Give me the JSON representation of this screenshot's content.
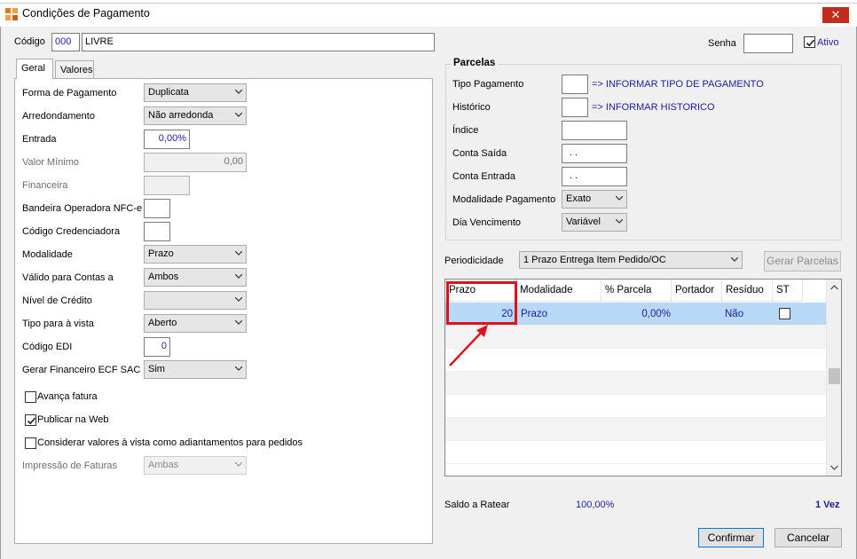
{
  "window": {
    "title": "Condições de Pagamento",
    "close": "✕"
  },
  "header": {
    "codigo_label": "Código",
    "codigo_value": "000",
    "descricao_value": "LIVRE",
    "senha_label": "Senha",
    "senha_value": "",
    "ativo_label": "Ativo",
    "ativo_checked": true
  },
  "tabs": [
    {
      "label": "Geral",
      "active": true
    },
    {
      "label": "Valores",
      "active": false
    }
  ],
  "geral": {
    "forma_pagamento": {
      "label": "Forma de Pagamento",
      "value": "Duplicata"
    },
    "arredondamento": {
      "label": "Arredondamento",
      "value": "Não arredonda"
    },
    "entrada": {
      "label": "Entrada",
      "value": "0,00%"
    },
    "valor_minimo": {
      "label": "Valor Mínimo",
      "value": "0,00"
    },
    "financeira": {
      "label": "Financeira",
      "value": ""
    },
    "bandeira": {
      "label": "Bandeira Operadora NFC-e",
      "value": ""
    },
    "credenciadora": {
      "label": "Código Credenciadora",
      "value": ""
    },
    "modalidade": {
      "label": "Modalidade",
      "value": "Prazo"
    },
    "valido_contas": {
      "label": "Válido para Contas a",
      "value": "Ambos"
    },
    "nivel_credito": {
      "label": "Nível de Crédito",
      "value": ""
    },
    "tipo_vista": {
      "label": "Tipo para à vista",
      "value": "Aberto"
    },
    "codigo_edi": {
      "label": "Código EDI",
      "value": "0"
    },
    "gerar_financeiro": {
      "label": "Gerar Financeiro ECF SAC",
      "value": "Sim"
    },
    "avanca_fatura": {
      "label": "Avança fatura",
      "checked": false
    },
    "publicar_web": {
      "label": "Publicar na Web",
      "checked": true
    },
    "considerar_valores": {
      "label": "Considerar valores à vista como adiantamentos para pedidos",
      "checked": false
    },
    "impressao_faturas": {
      "label": "Impressão de Faturas",
      "value": "Ambas"
    }
  },
  "parcelas": {
    "title": "Parcelas",
    "tipo_pagamento": {
      "label": "Tipo Pagamento",
      "value": "",
      "hint": "=> INFORMAR TIPO DE PAGAMENTO"
    },
    "historico": {
      "label": "Histórico",
      "value": "",
      "hint": "=> INFORMAR HISTORICO"
    },
    "indice": {
      "label": "Índice",
      "value": ""
    },
    "conta_saida": {
      "label": "Conta Saída",
      "value": ". ."
    },
    "conta_entrada": {
      "label": "Conta Entrada",
      "value": ". ."
    },
    "modalidade_pagamento": {
      "label": "Modalidade Pagamento",
      "value": "Exato"
    },
    "dia_vencimento": {
      "label": "Dia Vencimento",
      "value": "Variável"
    }
  },
  "periodicidade": {
    "label": "Periodicidade",
    "value": "1 Prazo Entrega Item Pedido/OC"
  },
  "gerar_parcelas_label": "Gerar Parcelas",
  "grid": {
    "columns": [
      "Prazo",
      "Modalidade",
      "% Parcela",
      "Portador",
      "Resíduo",
      "ST"
    ],
    "rows": [
      {
        "prazo": "20",
        "modalidade": "Prazo",
        "parcela": "0,00%",
        "portador": "",
        "residuo": "Não",
        "st": false
      }
    ]
  },
  "footer": {
    "saldo_label": "Saldo a Ratear",
    "saldo_value": "100,00%",
    "vezes": "1 Vez",
    "confirmar": "Confirmar",
    "cancelar": "Cancelar"
  },
  "colors": {
    "accent": "#0078d7",
    "close": "#c42b1c",
    "highlight": "#e0101a",
    "selected_row": "#b8d8f8",
    "value_blue": "#1c1ca0"
  }
}
